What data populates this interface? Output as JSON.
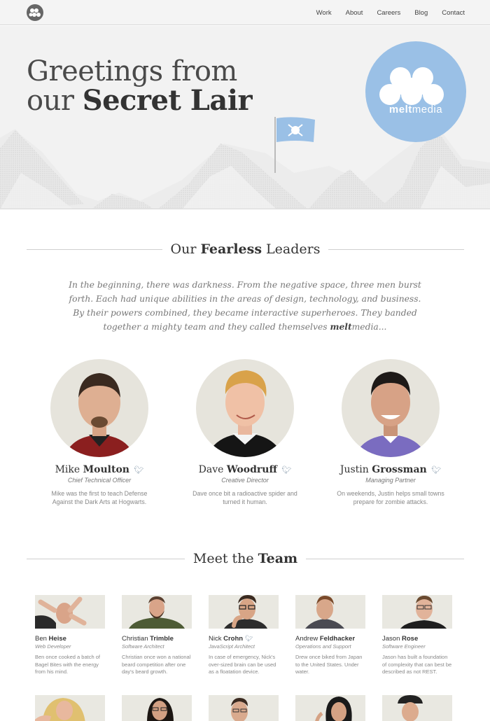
{
  "nav": {
    "items": [
      "Work",
      "About",
      "Careers",
      "Blog",
      "Contact"
    ]
  },
  "hero": {
    "line1": "Greetings from",
    "line2_pre": "our ",
    "line2_bold": "Secret Lair",
    "badge_word_bold": "melt",
    "badge_word_rest": "media"
  },
  "leaders_section": {
    "title_pre": "Our ",
    "title_bold": "Fearless",
    "title_post": " Leaders",
    "intro": "In the beginning, there was darkness. From the negative space, three men burst forth. Each had unique abilities in the areas of design, technology, and business. By their powers combined, they became interactive superheroes. They banded together a mighty team and they called themselves ",
    "intro_brand": "melt",
    "intro_brand_rest": "media..."
  },
  "leaders": [
    {
      "first": "Mike",
      "last": "Moulton",
      "role": "Chief Technical Officer",
      "bio": "Mike was the first to teach Defense Against the Dark Arts at Hogwarts."
    },
    {
      "first": "Dave",
      "last": "Woodruff",
      "role": "Creative Director",
      "bio": "Dave once bit a radioactive spider and turned it human."
    },
    {
      "first": "Justin",
      "last": "Grossman",
      "role": "Managing Partner",
      "bio": "On weekends, Justin helps small towns prepare for zombie attacks."
    }
  ],
  "team_section": {
    "title_pre": "Meet the ",
    "title_bold": "Team"
  },
  "team": [
    {
      "first": "Ben",
      "last": "Heise",
      "role": "Web Developer",
      "bio": "Ben once cooked a batch of Bagel Bites with the energy from his mind.",
      "twitter": false
    },
    {
      "first": "Christian",
      "last": "Trimble",
      "role": "Software Architect",
      "bio": "Christian once won a national beard competition after one day's beard growth.",
      "twitter": false
    },
    {
      "first": "Nick",
      "last": "Crohn",
      "role": "JavaScript Architect",
      "bio": "In case of emergency, Nick's over-sized brain can be used as a floatation device.",
      "twitter": true
    },
    {
      "first": "Andrew",
      "last": "Feldhacker",
      "role": "Operations and Support",
      "bio": "Drew once biked from Japan to the United States. Under water.",
      "twitter": false
    },
    {
      "first": "Jason",
      "last": "Rose",
      "role": "Software Engineer",
      "bio": "Jason has built a foundation of complexity that can best be described as not REST.",
      "twitter": false
    }
  ],
  "colors": {
    "accent_blue": "#9ac0e6",
    "text_dark": "#333333",
    "muted": "#888888"
  }
}
